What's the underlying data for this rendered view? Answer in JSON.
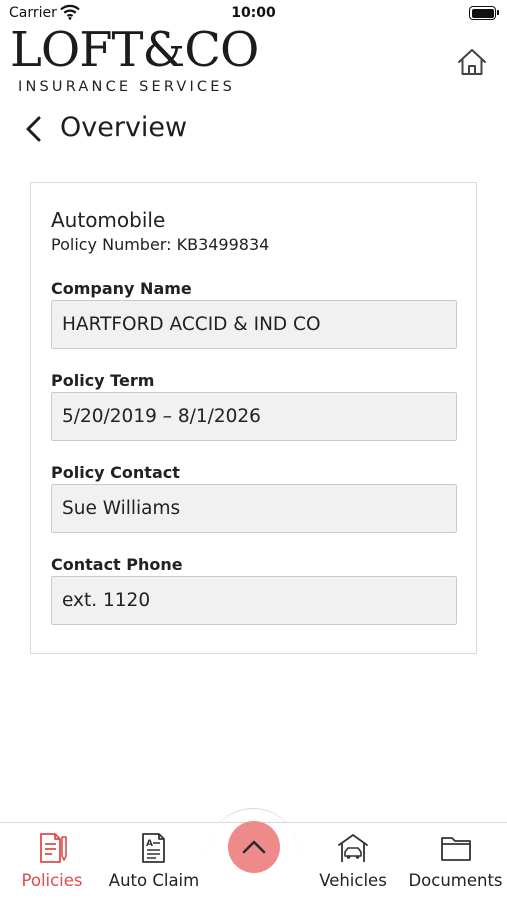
{
  "status_bar": {
    "carrier": "Carrier",
    "time": "10:00"
  },
  "header": {
    "logo_main": "LOFT&CO",
    "logo_sub": "INSURANCE SERVICES",
    "home_icon": "home-icon"
  },
  "nav_bar": {
    "back_icon": "chevron-left-icon",
    "title": "Overview"
  },
  "policy": {
    "type": "Automobile",
    "number_label": "Policy Number:",
    "number": "KB3499834",
    "fields": [
      {
        "label": "Company Name",
        "value": "HARTFORD ACCID & IND CO"
      },
      {
        "label": "Policy Term",
        "value": "5/20/2019 – 8/1/2026"
      },
      {
        "label": "Policy Contact",
        "value": "Sue Williams"
      },
      {
        "label": "Contact Phone",
        "value": "ext. 1120"
      }
    ]
  },
  "tab_bar": {
    "items": [
      {
        "label": "Policies",
        "icon": "policies-document-icon",
        "active": true
      },
      {
        "label": "Auto Claim",
        "icon": "auto-claim-form-icon",
        "active": false
      },
      {
        "label": "Vehicles",
        "icon": "vehicle-garage-icon",
        "active": false
      },
      {
        "label": "Documents",
        "icon": "folder-icon",
        "active": false
      }
    ],
    "center_button_icon": "chevron-up-icon"
  },
  "colors": {
    "accent": "#e14b4b",
    "fab": "#ef8a8a",
    "field_bg": "#f1f1f1"
  }
}
